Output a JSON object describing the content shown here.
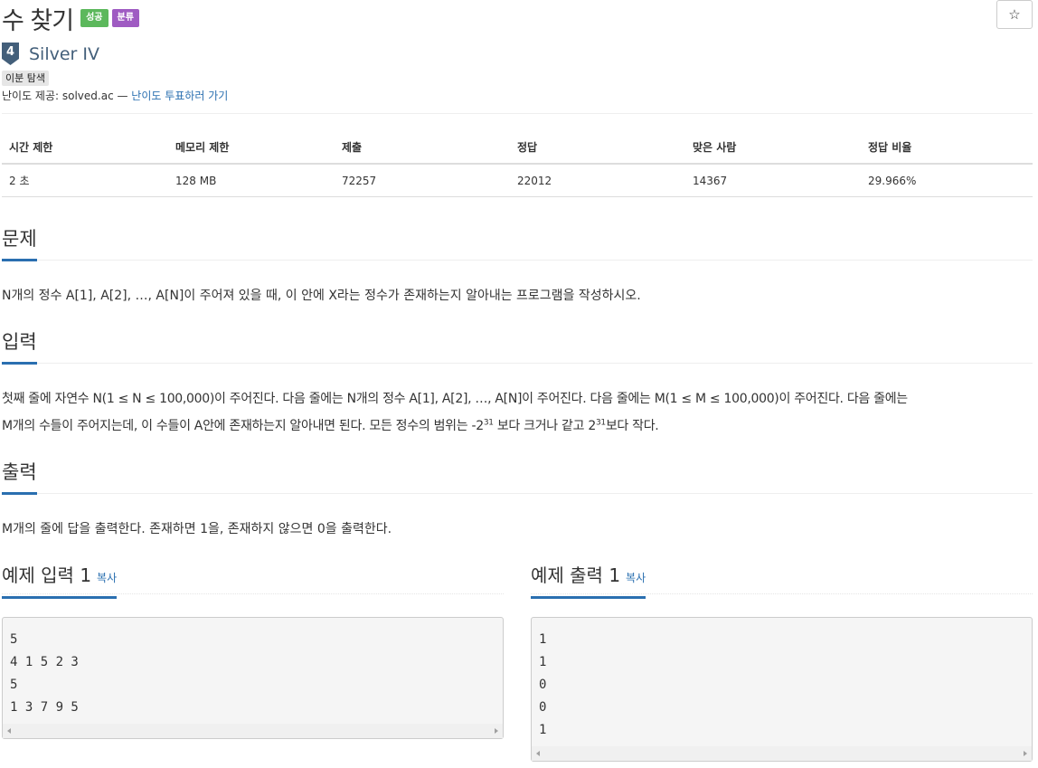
{
  "problem": {
    "title": "수 찾기",
    "badges": {
      "result": "성공",
      "category": "분류"
    },
    "star_icon": "☆",
    "tier": {
      "number": "4",
      "name": "Silver IV",
      "color": "#435f7a"
    },
    "algorithm_tag": "이분 탐색",
    "difficulty": {
      "prefix": "난이도 제공: solved.ac — ",
      "vote_link": "난이도 투표하러 가기"
    }
  },
  "info_table": {
    "headers": [
      "시간 제한",
      "메모리 제한",
      "제출",
      "정답",
      "맞은 사람",
      "정답 비율"
    ],
    "values": [
      "2 초",
      "128 MB",
      "72257",
      "22012",
      "14367",
      "29.966%"
    ]
  },
  "sections": {
    "description": {
      "title": "문제",
      "text": "N개의 정수 A[1], A[2], …, A[N]이 주어져 있을 때, 이 안에 X라는 정수가 존재하는지 알아내는 프로그램을 작성하시오."
    },
    "input": {
      "title": "입력",
      "line1": "첫째 줄에 자연수 N(1 ≤ N ≤ 100,000)이 주어진다. 다음 줄에는 N개의 정수 A[1], A[2], …, A[N]이 주어진다. 다음 줄에는 M(1 ≤ M ≤ 100,000)이 주어진다. 다음 줄에는",
      "line2_a": "M개의 수들이 주어지는데, 이 수들이 A안에 존재하는지 알아내면 된다. 모든 정수의 범위는 -2",
      "exp1": "31",
      "line2_b": " 보다 크거나 같고 2",
      "exp2": "31",
      "line2_c": "보다 작다."
    },
    "output": {
      "title": "출력",
      "text": "M개의 줄에 답을 출력한다. 존재하면 1을, 존재하지 않으면 0을 출력한다."
    }
  },
  "samples": {
    "input": {
      "title": "예제 입력 1",
      "copy_label": "복사",
      "content": "5\n4 1 5 2 3\n5\n1 3 7 9 5"
    },
    "output": {
      "title": "예제 출력 1",
      "copy_label": "복사",
      "content": "1\n1\n0\n0\n1"
    }
  },
  "colors": {
    "accent": "#2a6fb0",
    "badge_success": "#5cb85c",
    "badge_category": "#9f5bc2"
  }
}
